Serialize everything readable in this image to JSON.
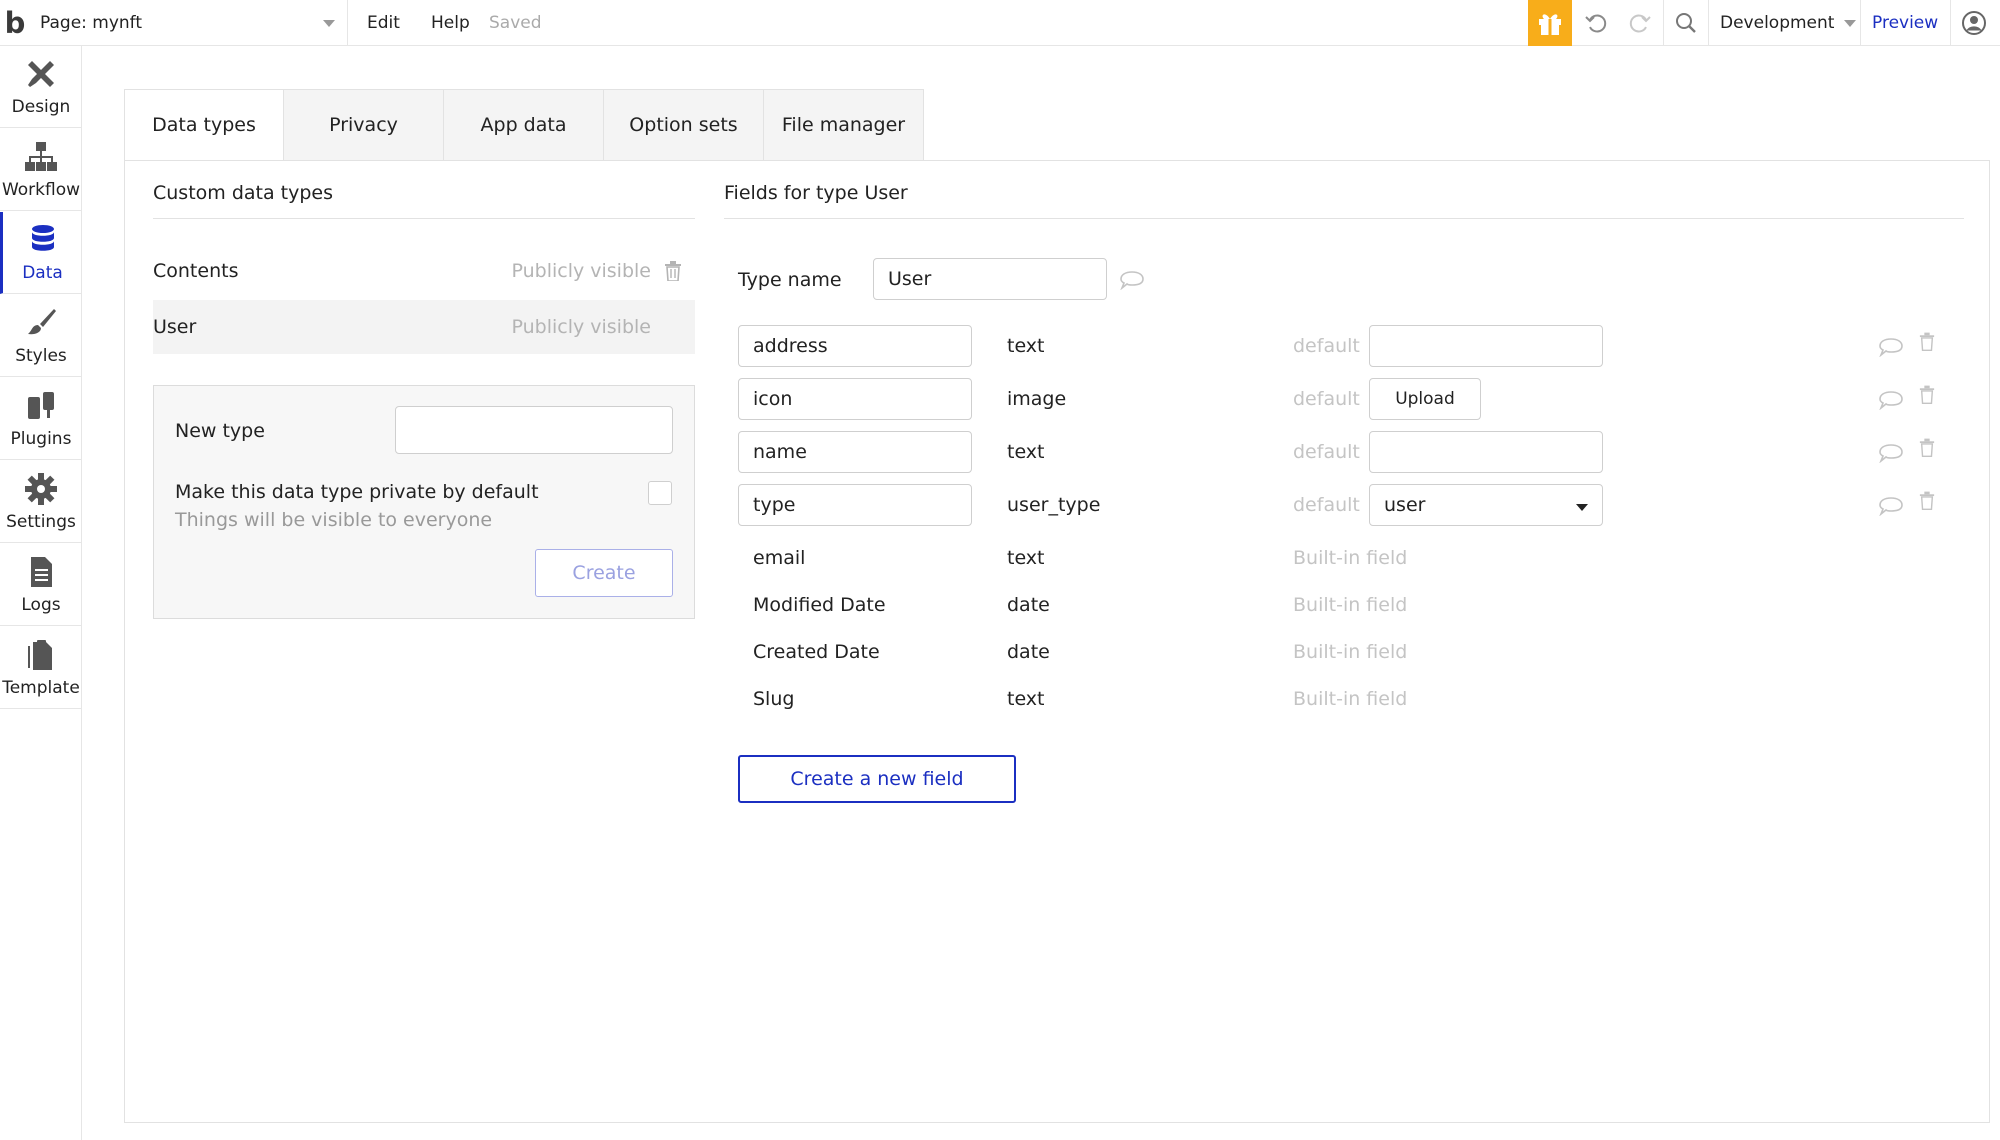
{
  "topbar": {
    "logo": "b",
    "page_label": "Page: mynft",
    "menu": {
      "edit": "Edit",
      "help": "Help",
      "status": "Saved"
    },
    "environment": "Development",
    "preview": "Preview",
    "icons": [
      "gift-icon",
      "undo-icon",
      "redo-icon",
      "search-icon",
      "user-account-icon"
    ],
    "accent_color": "#f8ad1a"
  },
  "sidebar": {
    "items": [
      {
        "label": "Design",
        "icon": "design-tools-icon"
      },
      {
        "label": "Workflow",
        "icon": "workflow-icon"
      },
      {
        "label": "Data",
        "icon": "database-icon",
        "active": true
      },
      {
        "label": "Styles",
        "icon": "brush-icon"
      },
      {
        "label": "Plugins",
        "icon": "plugins-icon"
      },
      {
        "label": "Settings",
        "icon": "gear-icon"
      },
      {
        "label": "Logs",
        "icon": "document-icon"
      },
      {
        "label": "Template",
        "icon": "template-icon"
      }
    ],
    "active_color": "#1b2fc1"
  },
  "tabs": [
    "Data types",
    "Privacy",
    "App data",
    "Option sets",
    "File manager"
  ],
  "left": {
    "heading": "Custom data types",
    "types": [
      {
        "name": "Contents",
        "visibility": "Publicly visible"
      },
      {
        "name": "User",
        "visibility": "Publicly visible"
      }
    ],
    "new_type": {
      "label": "New type",
      "value": "",
      "private_label": "Make this data type private by default",
      "private_sub": "Things will be visible to everyone",
      "create": "Create"
    }
  },
  "right": {
    "heading": "Fields for type User",
    "type_name_label": "Type name",
    "type_name_value": "User",
    "fields": [
      {
        "name": "address",
        "type": "text",
        "default_label": "default",
        "default_value": ""
      },
      {
        "name": "icon",
        "type": "image",
        "default_label": "default",
        "upload": "Upload"
      },
      {
        "name": "name",
        "type": "text",
        "default_label": "default",
        "default_value": ""
      },
      {
        "name": "type",
        "type": "user_type",
        "default_label": "default",
        "default_value": "user"
      }
    ],
    "builtin_fields": [
      {
        "name": "email",
        "type": "text",
        "note": "Built-in field"
      },
      {
        "name": "Modified Date",
        "type": "date",
        "note": "Built-in field"
      },
      {
        "name": "Created Date",
        "type": "date",
        "note": "Built-in field"
      },
      {
        "name": "Slug",
        "type": "text",
        "note": "Built-in field"
      }
    ],
    "new_field": "Create a new field"
  }
}
